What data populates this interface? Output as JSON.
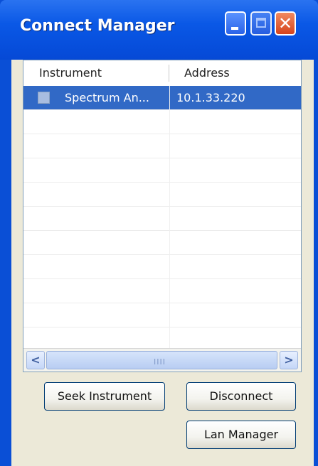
{
  "window": {
    "title": "Connect Manager",
    "buttons": {
      "close_glyph": "✕"
    }
  },
  "list": {
    "columns": [
      "Instrument",
      "Address"
    ],
    "rows": [
      {
        "instrument": "Spectrum An...",
        "address": "10.1.33.220",
        "selected": true
      }
    ],
    "scroll_grip": "IIII",
    "scroll_left": "<",
    "scroll_right": ">"
  },
  "buttons": {
    "seek": "Seek Instrument",
    "disconnect": "Disconnect",
    "lan_manager": "Lan Manager"
  },
  "colors": {
    "titlebar": "#0549d6",
    "selection": "#3169c6",
    "client": "#ece9d8"
  }
}
